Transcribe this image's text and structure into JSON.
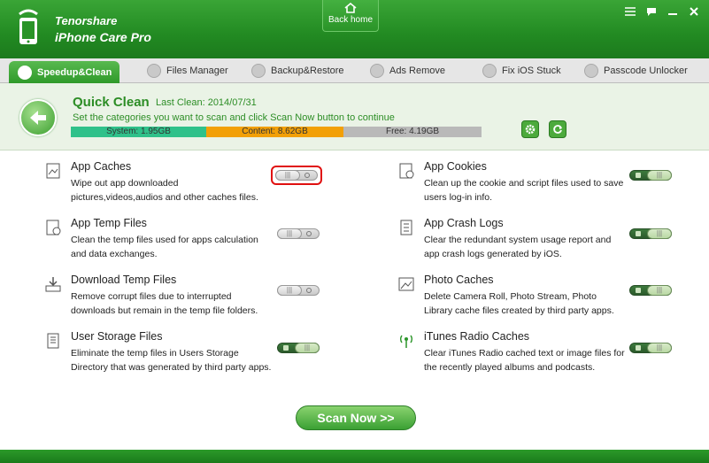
{
  "app": {
    "brand_line1": "Tenorshare",
    "brand_line2": "iPhone Care Pro"
  },
  "header": {
    "back_home": "Back home"
  },
  "tabs": [
    {
      "label": "Speedup&Clean",
      "active": true
    },
    {
      "label": "Files Manager"
    },
    {
      "label": "Backup&Restore"
    },
    {
      "label": "Ads Remove"
    },
    {
      "label": "Fix iOS Stuck"
    },
    {
      "label": "Passcode Unlocker"
    }
  ],
  "quick_clean": {
    "title": "Quick Clean",
    "last_clean": "Last Clean: 2014/07/31",
    "description": "Set the categories you want to scan and click Scan Now button to continue",
    "storage": {
      "system": "System: 1.95GB",
      "content": "Content: 8.62GB",
      "free": "Free: 4.19GB"
    }
  },
  "items": [
    {
      "title": "App Caches",
      "desc": "Wipe out app downloaded pictures,videos,audios and other caches files.",
      "enabled": false
    },
    {
      "title": "App Cookies",
      "desc": "Clean up the cookie and script files used to save users log-in info.",
      "enabled": true
    },
    {
      "title": "App Temp Files",
      "desc": "Clean the temp files used for apps calculation and data exchanges.",
      "enabled": false
    },
    {
      "title": "App Crash Logs",
      "desc": "Clear the redundant system usage report and app crash logs generated by iOS.",
      "enabled": true
    },
    {
      "title": "Download Temp Files",
      "desc": "Remove corrupt files due to interrupted downloads but remain in the temp file folders.",
      "enabled": false
    },
    {
      "title": "Photo Caches",
      "desc": "Delete Camera Roll, Photo Stream, Photo Library cache files created by third party apps.",
      "enabled": true
    },
    {
      "title": "User Storage Files",
      "desc": "Eliminate the temp files in Users Storage Directory that was generated by third party apps.",
      "enabled": true
    },
    {
      "title": "iTunes Radio Caches",
      "desc": "Clear iTunes Radio cached text or image files for the recently played albums and podcasts.",
      "enabled": true
    }
  ],
  "scan_button": "Scan Now >>"
}
